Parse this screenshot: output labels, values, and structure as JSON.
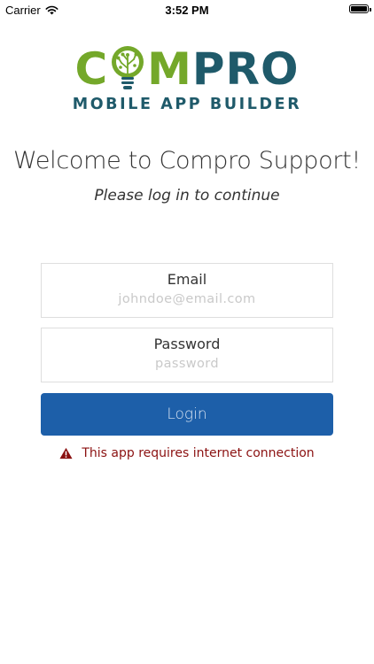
{
  "status_bar": {
    "carrier": "Carrier",
    "time": "3:52 PM",
    "icons": {
      "wifi": "wifi-icon",
      "battery": "battery-icon"
    },
    "battery_level": 1.0
  },
  "logo": {
    "word_c": "C",
    "word_m": "M",
    "word_pro": "PRO",
    "tagline": "MOBILE APP BUILDER",
    "colors": {
      "green": "#74a82a",
      "teal": "#1f5a6a"
    },
    "icon": "lightbulb-icon"
  },
  "welcome": {
    "title": "Welcome to Compro Support!",
    "subtitle": "Please log in to continue"
  },
  "form": {
    "email": {
      "label": "Email",
      "value": "",
      "placeholder": "johndoe@email.com"
    },
    "password": {
      "label": "Password",
      "value": "",
      "placeholder": "password"
    },
    "login_label": "Login",
    "button_color": "#1d5fa9"
  },
  "error": {
    "icon": "warning-icon",
    "message": "This app requires internet connection",
    "color": "#8b1111"
  }
}
